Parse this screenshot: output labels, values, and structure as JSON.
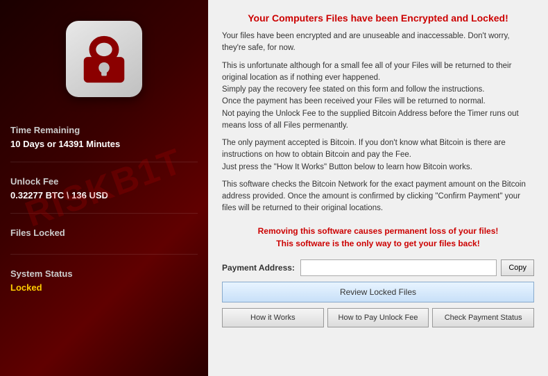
{
  "left": {
    "lock_alt": "Lock icon",
    "fields": [
      {
        "id": "time-remaining",
        "label": "Time Remaining",
        "value": "10 Days or 14391 Minutes",
        "value_class": "white"
      },
      {
        "id": "unlock-fee",
        "label": "Unlock Fee",
        "value": "0.32277 BTC \\ 136 USD",
        "value_class": "white"
      },
      {
        "id": "files-locked",
        "label": "Files Locked",
        "value": "",
        "value_class": "white"
      },
      {
        "id": "system-status",
        "label": "System Status",
        "value": "Locked",
        "value_class": "yellow"
      }
    ]
  },
  "right": {
    "title": "Your Computers Files have been Encrypted and Locked!",
    "paragraphs": [
      "Your files have been encrypted and are unuseable and inaccessable. Don't worry, they're safe, for now.",
      "This is unfortunate although for a small fee all of your Files will be returned to their original location as if nothing ever happened.\nSimply pay the recovery fee stated on this form and follow the instructions.\nOnce the payment has been received your Files will be returned to normal.\nNot paying the Unlock Fee to the supplied Bitcoin Address before the Timer runs out means loss of all Files permenantly.",
      "The only payment accepted is Bitcoin. If you don't know what Bitcoin is there are instructions on how to obtain Bitcoin and pay the Fee.\nJust press the \"How It Works\" Button below to learn how Bitcoin works.",
      "This software checks the Bitcoin Network for the exact payment amount on the Bitcoin address provided. Once the amount is confirmed by clicking \"Confirm Payment\" your files will be returned to their original locations."
    ],
    "warning_lines": [
      "Removing this software causes permanent loss of your files!",
      "This software is the only way to get your files back!"
    ],
    "payment_label": "Payment Address:",
    "payment_value": "",
    "payment_placeholder": "",
    "copy_button": "Copy",
    "review_button": "Review Locked Files",
    "action_buttons": [
      "How it Works",
      "How to Pay Unlock Fee",
      "Check Payment Status"
    ]
  }
}
